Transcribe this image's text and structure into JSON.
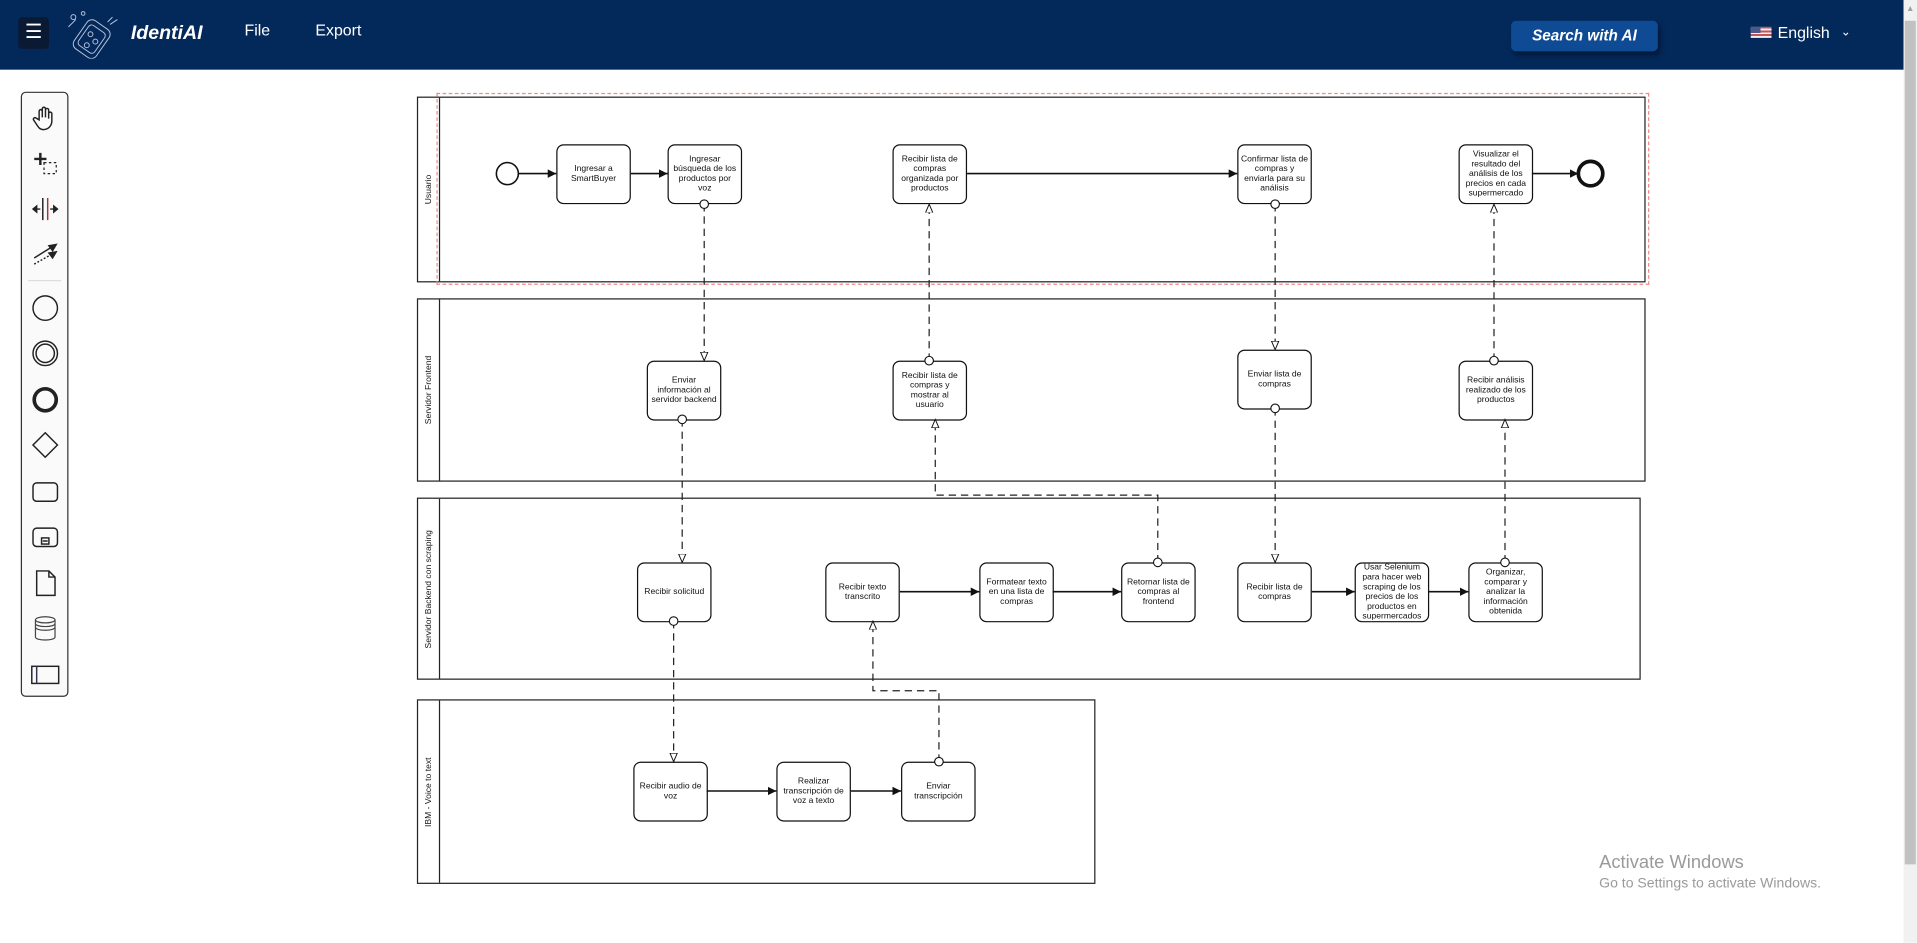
{
  "header": {
    "brand": "IdentiAI",
    "menu": [
      "File",
      "Export"
    ],
    "search_ai_label": "Search with AI",
    "language": "English",
    "colors": {
      "header_bg": "#03285a",
      "ai_button": "#0f4a94"
    }
  },
  "toolbar": {
    "tools": [
      "hand-tool-icon",
      "lasso-tool-icon",
      "space-tool-icon",
      "global-connect-icon",
      "start-event-icon",
      "intermediate-event-icon",
      "end-event-icon",
      "gateway-icon",
      "task-icon",
      "subprocess-icon",
      "data-object-icon",
      "data-store-icon",
      "pool-icon"
    ]
  },
  "diagram": {
    "pools": [
      "Usuario",
      "Servidor Frontend",
      "Servidor Backend con scraping",
      "IBM - Voice to text"
    ],
    "tasks": {
      "ingresar": "Ingresar a SmartBuyer",
      "busqueda": "Ingresar búsqueda de los productos por voz",
      "recibir_org": "Recibir lista de compras organizada por productos",
      "confirmar": "Confirmar lista de compras y enviarla para su análisis",
      "visualizar": "Visualizar el resultado del análisis de los precios en cada supermercado",
      "enviar_info": "Enviar información al servidor backend",
      "recibir_mostrar": "Recibir lista de compras y mostrar al usuario",
      "enviar_lista": "Enviar lista de compras",
      "recibir_analisis": "Recibir análisis realizado de los productos",
      "recibir_solicitud": "Recibir solicitud",
      "recibir_texto": "Recibir texto transcrito",
      "formatear": "Formatear texto en una lista de compras",
      "retornar": "Retornar lista de compras al frontend",
      "recibir_lista_back": "Recibir lista de compras",
      "selenium": "Usar Selenium para hacer web scraping de los precios de los productos en supermercados",
      "organizar": "Organizar, comparar y analizar la información obtenida",
      "recibir_audio": "Recibir audio de voz",
      "transcripcion": "Realizar transcripción de voz a texto",
      "enviar_transcripcion": "Enviar transcripción"
    }
  },
  "watermark": {
    "title": "Activate Windows",
    "subtitle": "Go to Settings to activate Windows."
  }
}
